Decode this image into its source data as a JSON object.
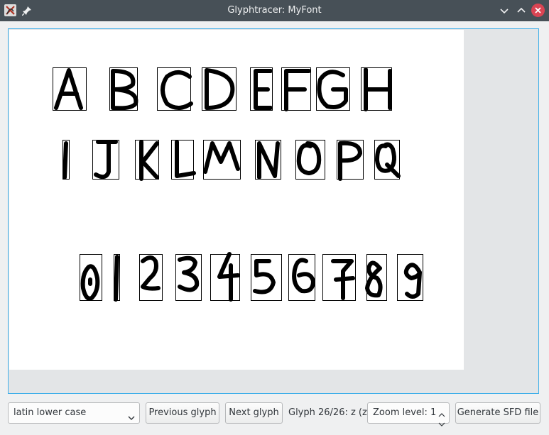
{
  "window": {
    "title": "Glyphtracer: MyFont"
  },
  "controls": {
    "charset": "latin lower case",
    "previous_label": "Previous glyph",
    "next_label": "Next glyph",
    "status": "Glyph 26/26: z (z)",
    "zoom": "Zoom level: 1",
    "generate_label": "Generate SFD file"
  },
  "colors": {
    "accent": "#3daee9",
    "titlebar": "#475057",
    "close": "#da4453"
  },
  "icons": [
    "app-icon",
    "pin-icon",
    "minimize-icon",
    "maximize-icon",
    "close-icon",
    "chevron-down-icon",
    "spin-up-icon",
    "spin-down-icon"
  ],
  "glyph_rows": [
    [
      "A",
      "B",
      "C",
      "D",
      "E",
      "F",
      "G",
      "H"
    ],
    [
      "I",
      "J",
      "K",
      "L",
      "M",
      "N",
      "O",
      "P",
      "Q"
    ],
    [
      "0",
      "1",
      "2",
      "3",
      "4",
      "5",
      "6",
      "7",
      "8",
      "9"
    ]
  ]
}
